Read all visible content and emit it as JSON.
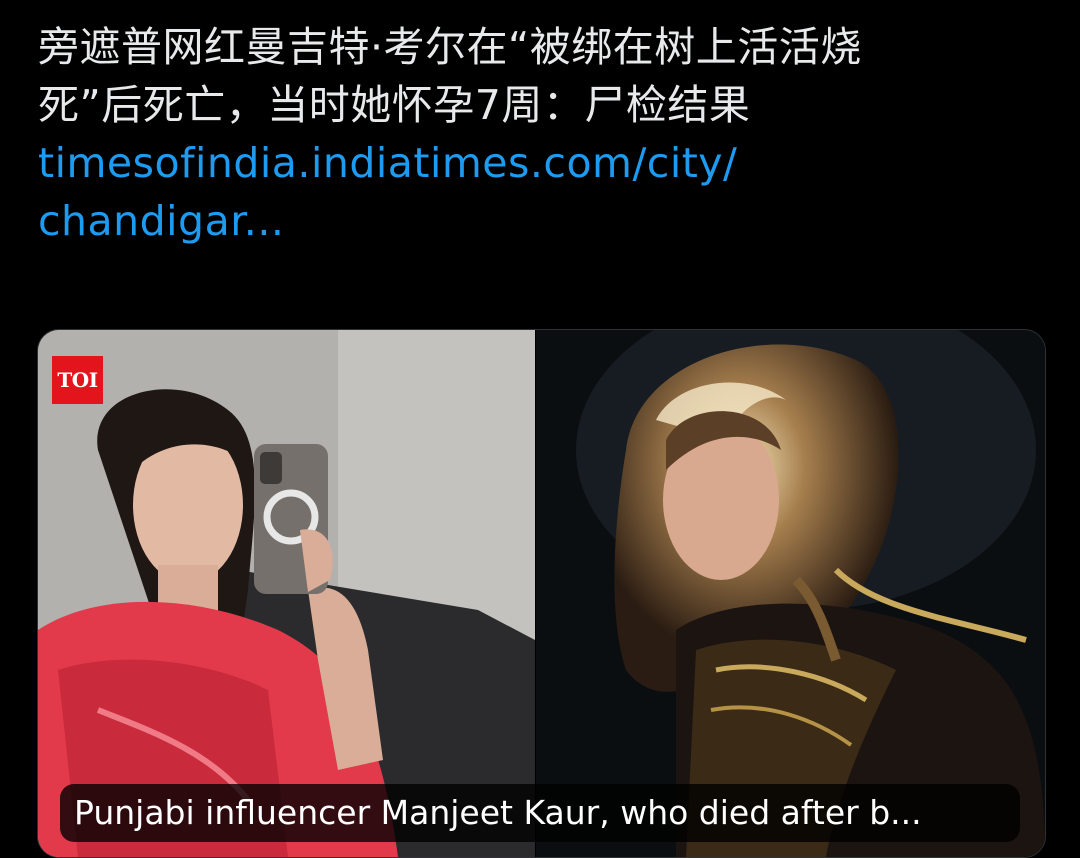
{
  "tweet": {
    "text_line1": "旁遮普网红曼吉特·考尔在“被绑在树上活活烧",
    "text_line2": "死”后死亡，当时她怀孕7周：尸检结果",
    "link_line1": "timesofindia.indiatimes.com/city/",
    "link_line2": "chandigar..."
  },
  "media_card": {
    "logo_text": "TOI",
    "logo_color": "#e3141b",
    "caption": "Punjabi influencer Manjeet Kaur, who died after b..."
  },
  "colors": {
    "background": "#000000",
    "text": "#e7e9ea",
    "link": "#1d9bf0"
  }
}
